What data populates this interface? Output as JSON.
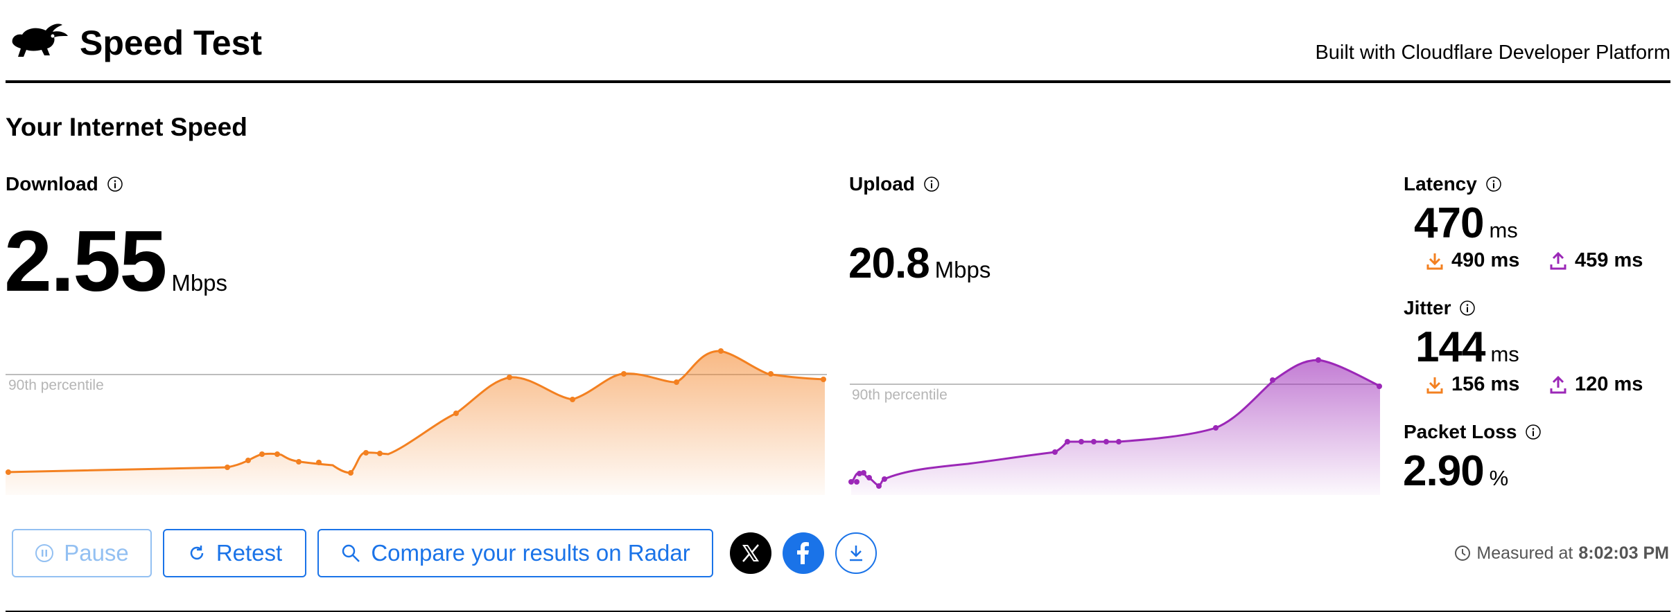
{
  "header": {
    "title": "Speed Test",
    "built_with": "Built with Cloudflare Developer Platform"
  },
  "section_title": "Your Internet Speed",
  "download": {
    "label": "Download",
    "value": "2.55",
    "unit": "Mbps",
    "chart_label": "90th percentile",
    "color": "#f38020"
  },
  "upload": {
    "label": "Upload",
    "value": "20.8",
    "unit": "Mbps",
    "chart_label": "90th percentile",
    "color": "#9b27b7"
  },
  "latency": {
    "label": "Latency",
    "value": "470",
    "unit": "ms",
    "down_value": "490 ms",
    "up_value": "459 ms"
  },
  "jitter": {
    "label": "Jitter",
    "value": "144",
    "unit": "ms",
    "down_value": "156 ms",
    "up_value": "120 ms"
  },
  "packet_loss": {
    "label": "Packet Loss",
    "value": "2.90",
    "unit": "%"
  },
  "actions": {
    "pause": "Pause",
    "retest": "Retest",
    "compare": "Compare your results on Radar"
  },
  "measured": {
    "prefix": "Measured at",
    "time": "8:02:03 PM"
  },
  "icons": {
    "logo": "rabbit-icon",
    "info": "info-icon",
    "download": "download-arrow-icon",
    "upload": "upload-arrow-icon",
    "pause": "pause-icon",
    "retest": "refresh-icon",
    "search": "search-icon",
    "x": "x-logo-icon",
    "facebook": "facebook-icon",
    "save": "download-icon",
    "clock": "clock-icon"
  }
}
